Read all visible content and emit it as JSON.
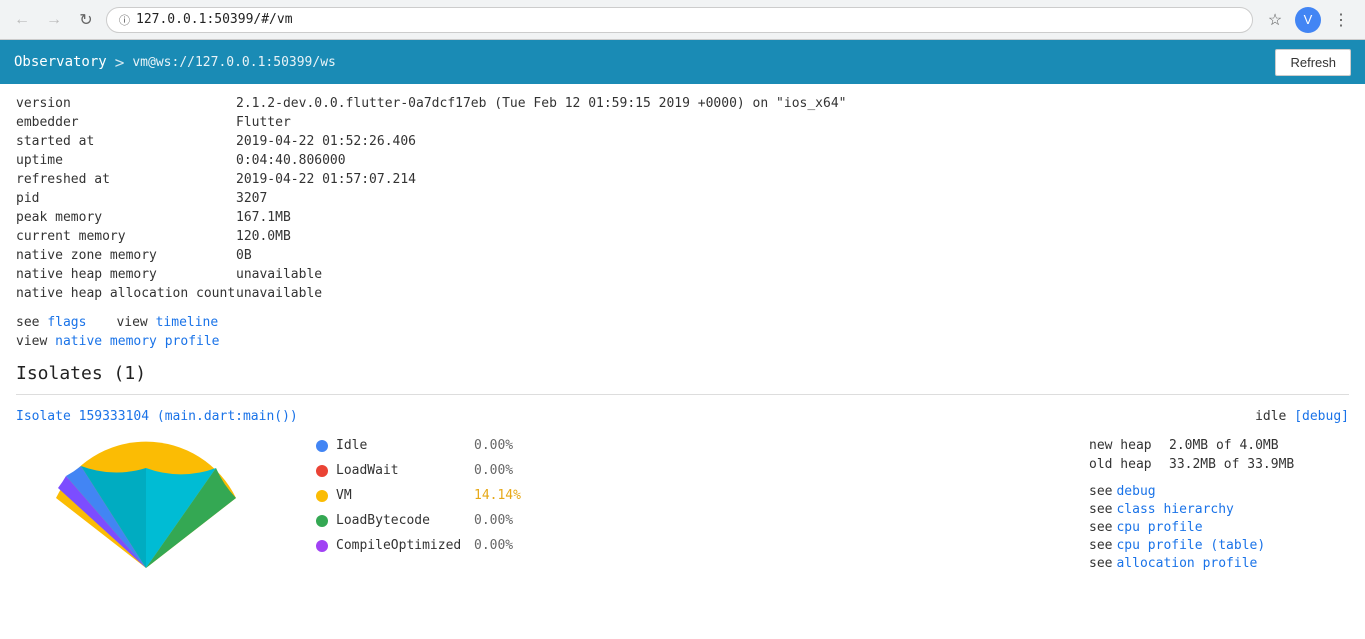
{
  "browser": {
    "url": "127.0.0.1:50399/#/vm",
    "url_display": "127.0.0.1:50399/#/vm",
    "back_enabled": false,
    "forward_enabled": false
  },
  "header": {
    "app_name": "Observatory",
    "separator": ">",
    "path": "vm@ws://127.0.0.1:50399/ws",
    "refresh_label": "Refresh"
  },
  "vm_info": {
    "rows": [
      {
        "label": "version",
        "value": "2.1.2-dev.0.0.flutter-0a7dcf17eb (Tue Feb 12 01:59:15 2019 +0000) on \"ios_x64\""
      },
      {
        "label": "embedder",
        "value": "Flutter"
      },
      {
        "label": "started at",
        "value": "2019-04-22 01:52:26.406"
      },
      {
        "label": "uptime",
        "value": "0:04:40.806000"
      },
      {
        "label": "refreshed at",
        "value": "2019-04-22 01:57:07.214"
      },
      {
        "label": "pid",
        "value": "3207"
      },
      {
        "label": "peak memory",
        "value": "167.1MB"
      },
      {
        "label": "current memory",
        "value": "120.0MB"
      },
      {
        "label": "native zone memory",
        "value": "0B"
      },
      {
        "label": "native heap memory",
        "value": "unavailable"
      },
      {
        "label": "native heap allocation count",
        "value": "unavailable"
      }
    ]
  },
  "links": {
    "see_prefix": "see",
    "flags_label": "flags",
    "view_prefix1": "view",
    "timeline_label": "timeline",
    "view_prefix2": "view",
    "native_memory_label": "native memory profile"
  },
  "isolates_section": {
    "title": "Isolates (1)",
    "isolate": {
      "link_label": "Isolate 159333104 (main.dart:main())",
      "status_label": "idle",
      "debug_label": "[debug]",
      "new_heap_label": "new heap",
      "new_heap_value": "2.0MB of 4.0MB",
      "old_heap_label": "old heap",
      "old_heap_value": "33.2MB of 33.9MB",
      "see_links": [
        {
          "prefix": "see",
          "label": "debug",
          "href": "#"
        },
        {
          "prefix": "see",
          "label": "class hierarchy",
          "href": "#"
        },
        {
          "prefix": "see",
          "label": "cpu profile",
          "href": "#"
        },
        {
          "prefix": "see",
          "label": "cpu profile (table)",
          "href": "#"
        },
        {
          "prefix": "see",
          "label": "allocation profile",
          "href": "#"
        }
      ]
    }
  },
  "chart": {
    "segments": [
      {
        "label": "Idle",
        "value": "0.00%",
        "color": "#4285f4",
        "percent": 0,
        "angle_start": 0,
        "angle_end": 0.5
      },
      {
        "label": "LoadWait",
        "value": "0.00%",
        "color": "#ea4335",
        "percent": 0,
        "angle_start": 0.5,
        "angle_end": 1
      },
      {
        "label": "VM",
        "value": "14.14%",
        "color": "#fbbc04",
        "percent": 14.14,
        "angle_start": 1,
        "angle_end": 180
      },
      {
        "label": "LoadBytecode",
        "value": "0.00%",
        "color": "#34a853",
        "percent": 0,
        "angle_start": 180,
        "angle_end": 181
      },
      {
        "label": "CompileOptimized",
        "value": "0.00%",
        "color": "#a142f4",
        "percent": 0,
        "angle_start": 181,
        "angle_end": 182
      }
    ]
  }
}
